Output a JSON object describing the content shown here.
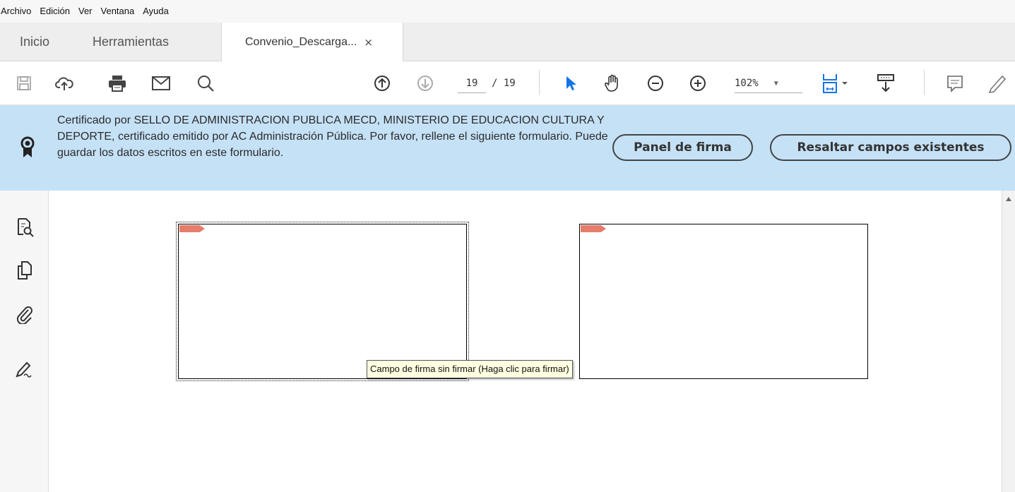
{
  "menu": {
    "items": [
      "Archivo",
      "Edición",
      "Ver",
      "Ventana",
      "Ayuda"
    ]
  },
  "tabs": {
    "home": "Inicio",
    "tools": "Herramientas",
    "document": "Convenio_Descarga...",
    "close_symbol": "×"
  },
  "toolbar": {
    "current_page": "19",
    "total_pages": "/ 19",
    "zoom": "102%",
    "icons": [
      "save-icon",
      "upload-cloud-icon",
      "print-icon",
      "email-icon",
      "search-icon",
      "page-up-icon",
      "page-down-icon",
      "select-arrow-icon",
      "hand-tool-icon",
      "zoom-out-icon",
      "zoom-in-icon",
      "zoom-dropdown-icon",
      "page-fit-icon",
      "read-mode-icon",
      "comment-icon",
      "pen-icon"
    ],
    "accent_color": "#1473e6"
  },
  "cert_bar": {
    "message": "Certificado por SELLO DE ADMINISTRACION PUBLICA MECD, MINISTERIO DE EDUCACION CULTURA Y DEPORTE, certificado emitido por AC Administración Pública. Por favor, rellene el siguiente formulario. Puede guardar los datos escritos en este formulario.",
    "panel_button": "Panel de firma",
    "highlight_button": "Resaltar campos existentes",
    "background": "#c5e1f6"
  },
  "left_rail": {
    "icons": [
      "page-thumbnails-icon",
      "copy-pages-icon",
      "attachment-icon",
      "sign-icon"
    ]
  },
  "document": {
    "signature_fields": [
      {
        "name": "signature-field-1",
        "active": true
      },
      {
        "name": "signature-field-2",
        "active": false
      }
    ],
    "tooltip": "Campo de firma sin firmar (Haga clic para firmar)"
  }
}
